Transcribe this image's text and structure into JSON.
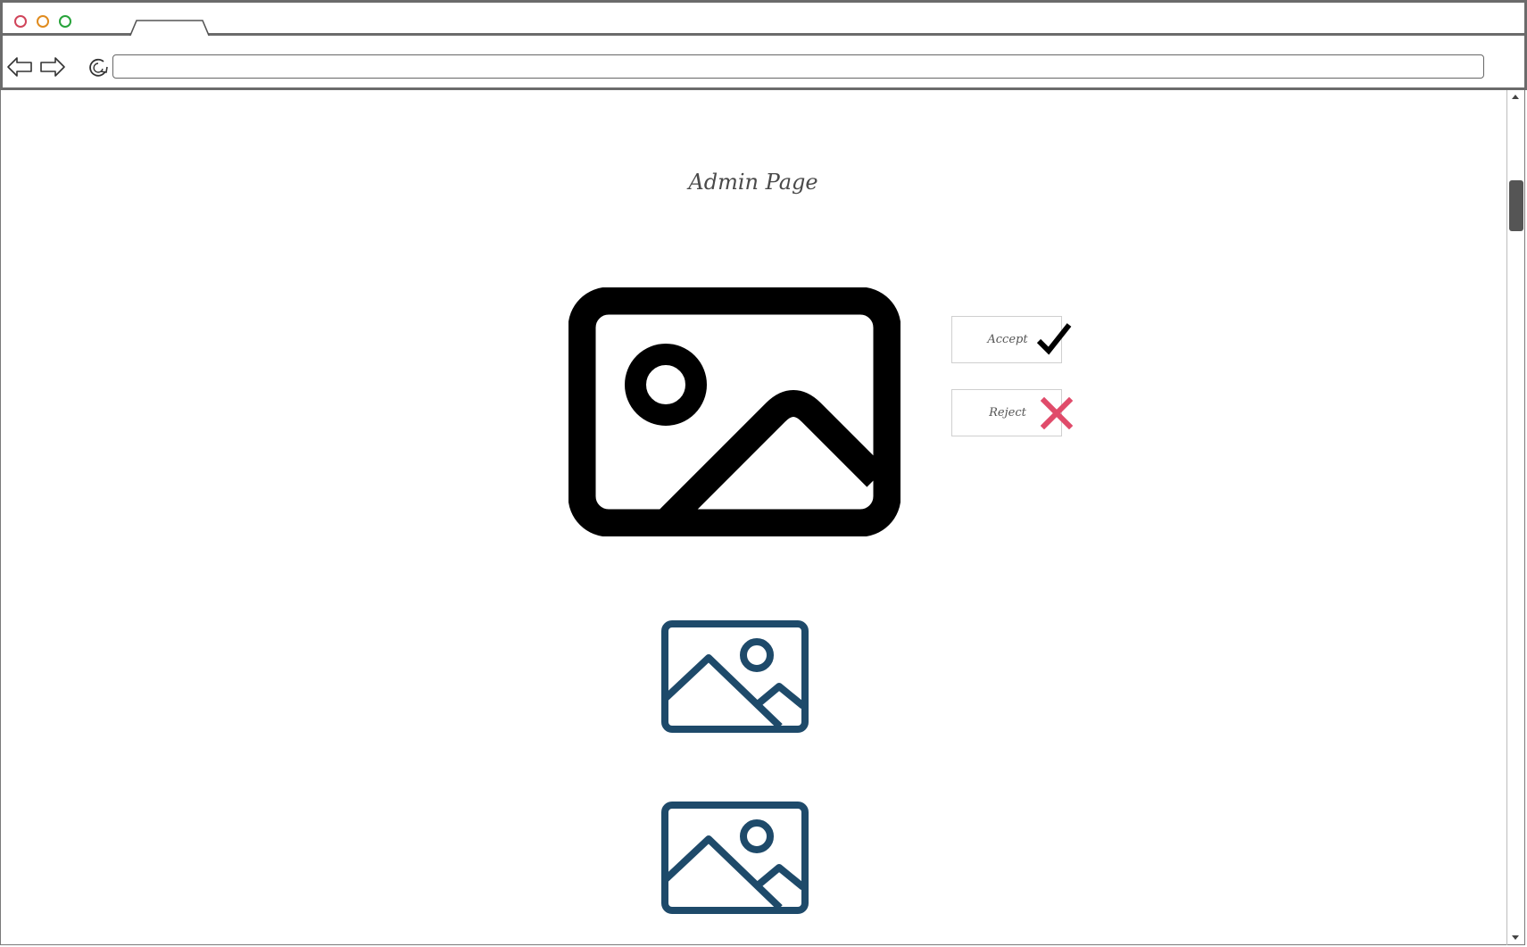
{
  "browser": {
    "tab_title": "",
    "url": ""
  },
  "page": {
    "title": "Admin Page"
  },
  "actions": {
    "accept_label": "Accept",
    "reject_label": "Reject"
  },
  "colors": {
    "accept_check": "#000000",
    "reject_x": "#e04b6a",
    "thumbnail": "#1e4a6a",
    "main_image": "#000000"
  },
  "icons": {
    "main": "image-placeholder-icon",
    "accept": "checkmark-icon",
    "reject": "x-icon",
    "thumbnails": [
      "image-thumbnail-icon",
      "image-thumbnail-icon"
    ]
  }
}
